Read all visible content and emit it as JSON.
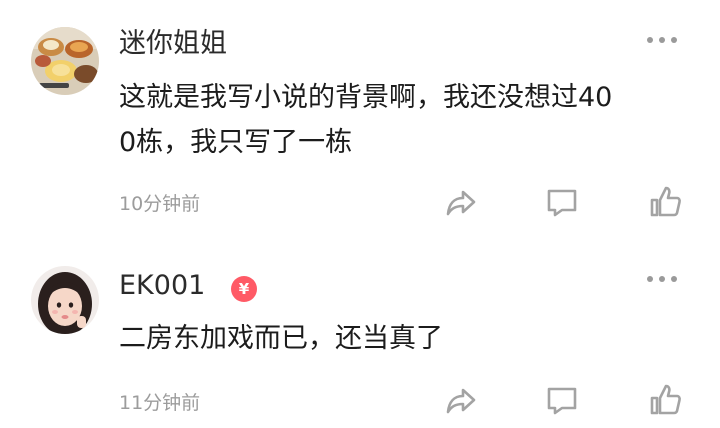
{
  "comments": [
    {
      "username": "迷你姐姐",
      "text_lines": [
        "这就是我写小说的背景啊，我还没想过40",
        "0栋，我只写了一栋"
      ],
      "time": "10分钟前"
    },
    {
      "username": "EK001",
      "badge": "¥",
      "text_lines": [
        "二房东加戏而已，还当真了"
      ],
      "time": "11分钟前"
    }
  ],
  "colors": {
    "username": "#2b2b2b",
    "text": "#1c1c1c",
    "meta": "#9c9c9c",
    "icon": "#a3a3a3",
    "badge": "#ff5a66"
  },
  "icons": {
    "more": "more-dots-icon",
    "share": "share-arrow-icon",
    "reply": "comment-bubble-icon",
    "like": "thumbs-up-icon"
  }
}
